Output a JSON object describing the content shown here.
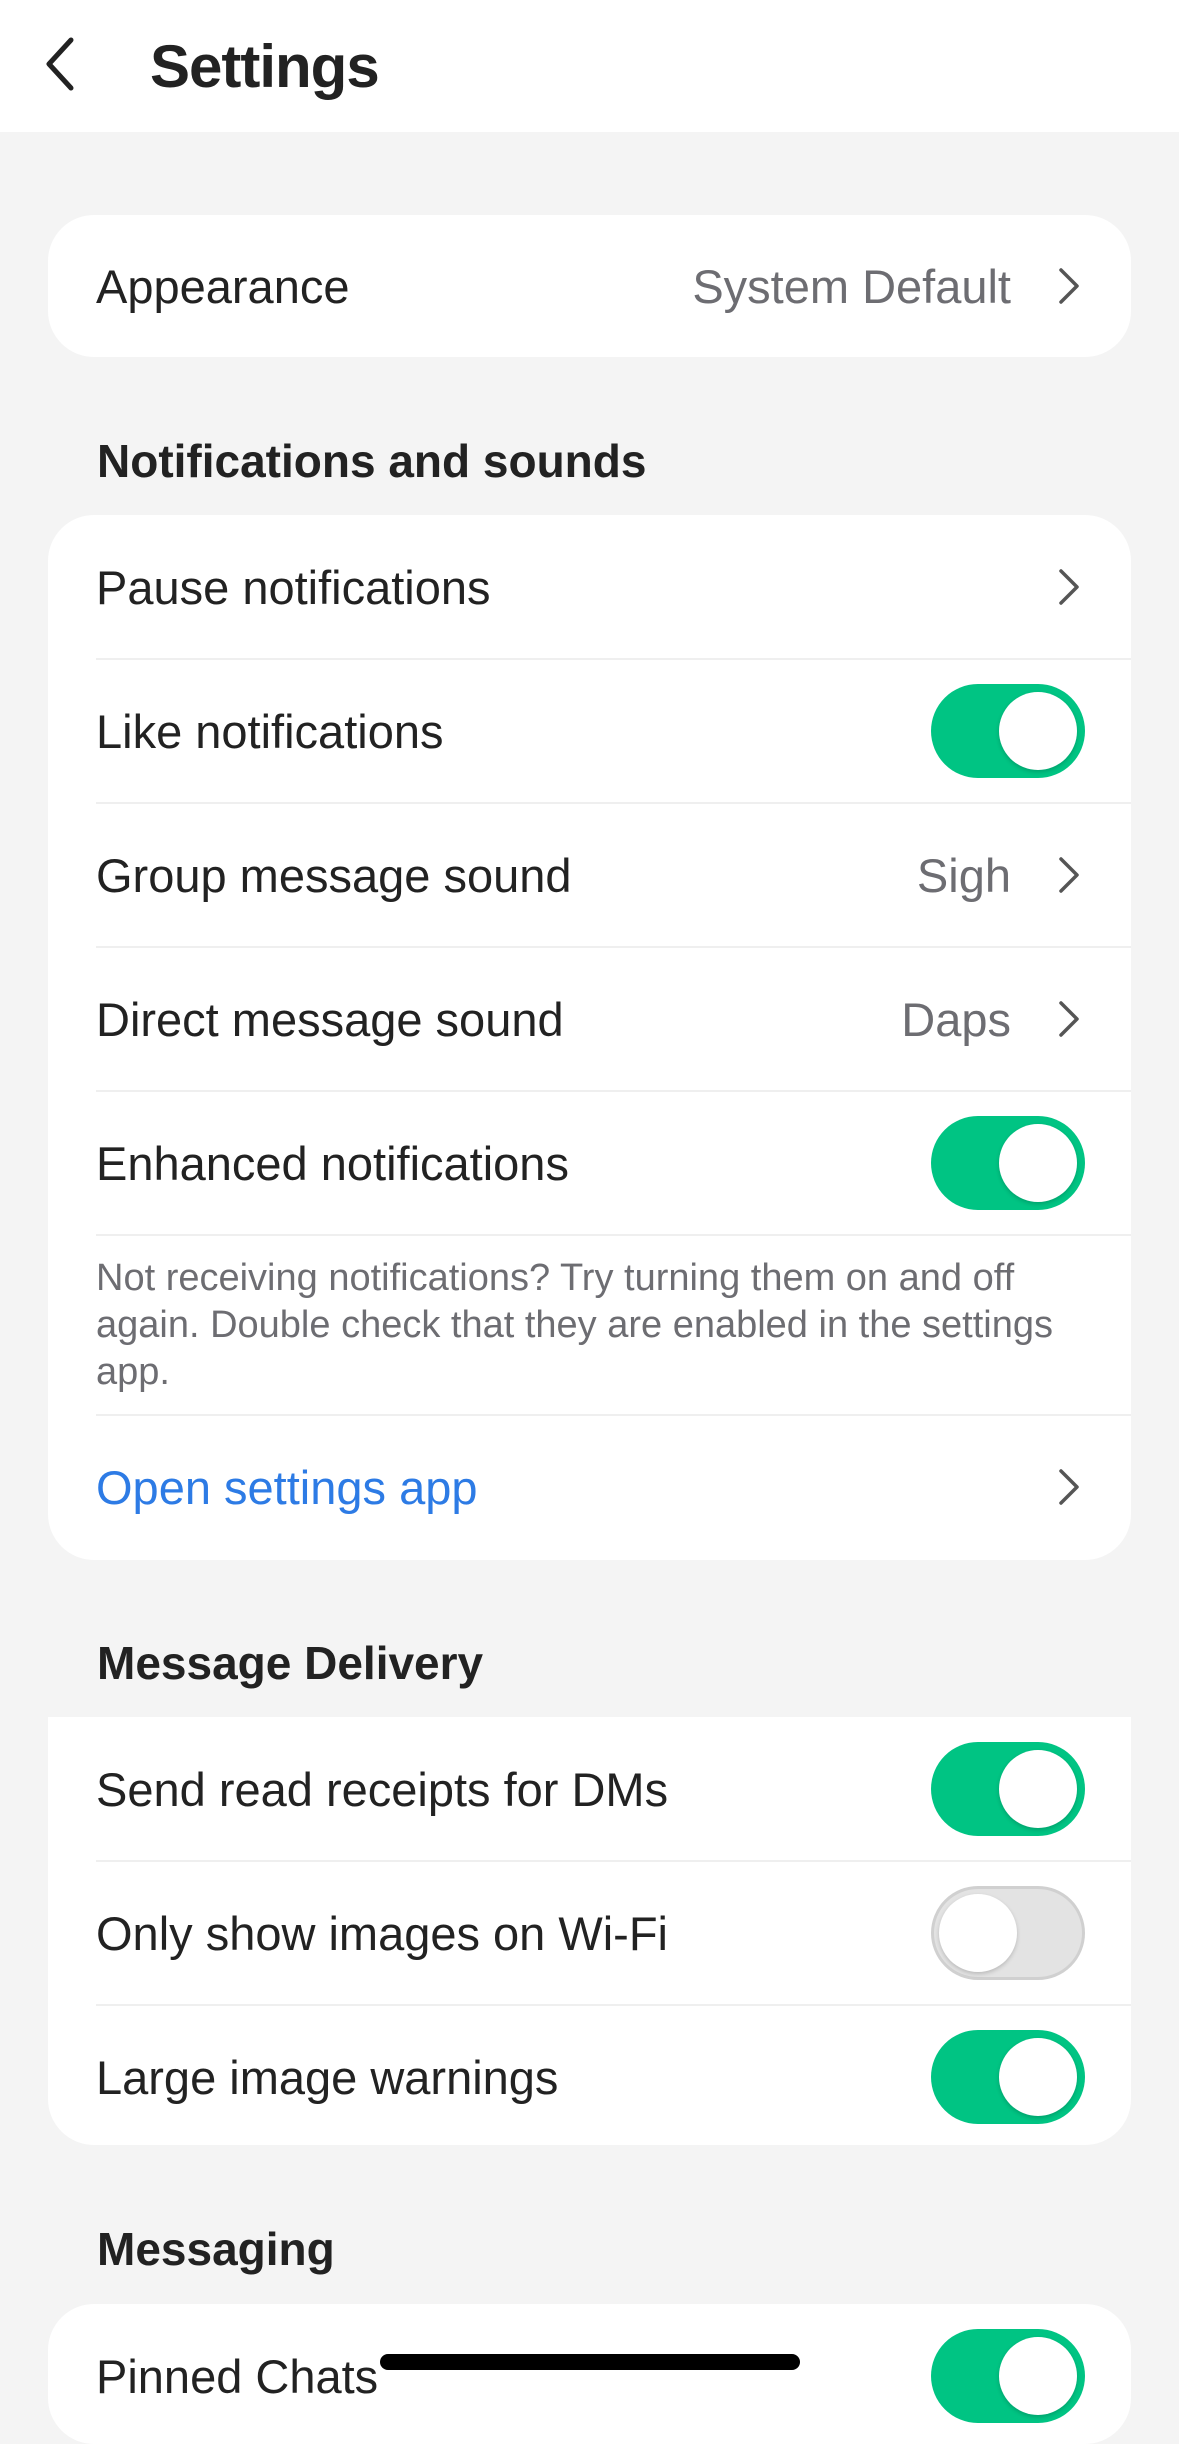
{
  "header": {
    "title": "Settings"
  },
  "appearance": {
    "label": "Appearance",
    "value": "System Default"
  },
  "notifications": {
    "section_title": "Notifications and sounds",
    "pause": {
      "label": "Pause notifications"
    },
    "like": {
      "label": "Like notifications",
      "on": true
    },
    "group_sound": {
      "label": "Group message sound",
      "value": "Sigh"
    },
    "direct_sound": {
      "label": "Direct message sound",
      "value": "Daps"
    },
    "enhanced": {
      "label": "Enhanced notifications",
      "on": true
    },
    "note": "Not receiving notifications? Try turning them on and off again. Double check that they are enabled in the settings app.",
    "open_settings": {
      "label": "Open settings app"
    }
  },
  "delivery": {
    "section_title": "Message Delivery",
    "read_receipts": {
      "label": "Send read receipts for DMs",
      "on": true
    },
    "wifi_images": {
      "label": "Only show images on Wi-Fi",
      "on": false
    },
    "large_image": {
      "label": "Large image warnings",
      "on": true
    }
  },
  "messaging": {
    "section_title": "Messaging",
    "pinned": {
      "label": "Pinned Chats",
      "on": true
    }
  },
  "colors": {
    "toggle_on": "#00c483",
    "link": "#2d7be5",
    "background": "#f4f4f4"
  },
  "icons": [
    "back-chevron-icon",
    "chevron-right-icon"
  ]
}
